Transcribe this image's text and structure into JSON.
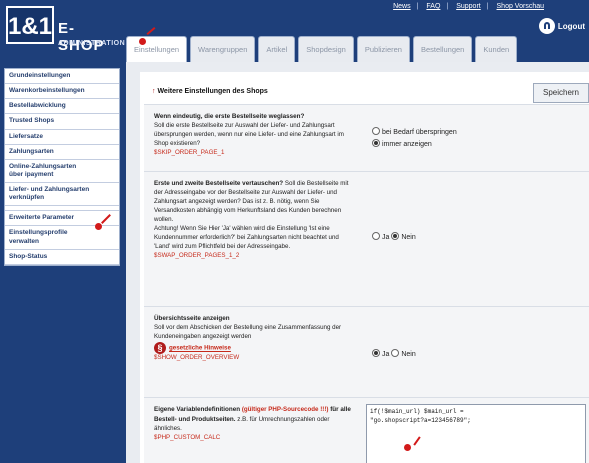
{
  "brand": {
    "logo": "1&1",
    "shop": "E-SHOP",
    "admin": "ADMINISTRATION"
  },
  "toplinks": [
    "News",
    "FAQ",
    "Support",
    "Shop Vorschau"
  ],
  "logout_label": "Logout",
  "tabs": [
    "Einstellungen",
    "Warengruppen",
    "Artikel",
    "Shopdesign",
    "Publizieren",
    "Bestellungen",
    "Kunden"
  ],
  "sidebar": {
    "items": [
      "Grundeinstellungen",
      "Warenkorbeinstellungen",
      "Bestellabwicklung",
      "Trusted Shops",
      "Liefersatze",
      "Zahlungsarten",
      "Online-Zahlungsarten\nüber ipayment",
      "Liefer- und Zahlungsarten\nverknüpfen"
    ],
    "items2": [
      "Erweiterte Parameter",
      "Einstellungsprofile\nverwalten",
      "Shop-Status"
    ]
  },
  "heading": "Weitere Einstellungen des Shops",
  "save_label": "Speichern",
  "settings": [
    {
      "title": "Wenn eindeutig, die erste Bestellseite weglassen?",
      "text": "Soll die erste Bestellseite zur Auswahl der Liefer- und Zahlungsart übersprungen werden, wenn nur eine Liefer- und eine Zahlungsart im Shop existieren?",
      "var": "$SKIP_ORDER_PAGE_1",
      "options": [
        "bei Bedarf überspringen",
        "immer anzeigen"
      ]
    },
    {
      "title": "Erste und zweite Bestellseite vertauschen?",
      "text": "Soll die Bestellseite mit der Adresseingabe vor der Bestellseite zur Auswahl der Liefer- und Zahlungsart angezeigt werden? Das ist z. B. nötig, wenn Sie Versandkosten abhängig vom Herkunftsland des Kunden berechnen wollen.",
      "warning": "Achtung! Wenn Sie Hier 'Ja' wählen wird die Einstellung 'Ist eine Kundennummer erforderlich?' bei Zahlungsarten nicht beachtet und 'Land' wird zum Pflichtfeld bei der Adresseingabe.",
      "var": "$SWAP_ORDER_PAGES_1_2",
      "options": [
        "Ja",
        "Nein"
      ]
    },
    {
      "title": "Übersichtsseite anzeigen",
      "text": "Soll vor dem Abschicken der Bestellung eine Zusammenfassung der Kundeneingaben angezeigt werden",
      "link": "gesetzliche Hinweise",
      "var": "$SHOW_ORDER_OVERVIEW",
      "options": [
        "Ja",
        "Nein"
      ]
    },
    {
      "title": "Eigene Variablendefinitionen",
      "title_red": "(gültiger PHP-Sourcecode !!!)",
      "title_end": "für alle Bestell- und Produktseiten.",
      "text": "z.B. für Umrechnungszahlen oder ähnliches.",
      "var": "$PHP_CUSTOM_CALC",
      "code": "if(!$main_url) $main_url =\n\"go.shopscript?a=123456789\";"
    }
  ]
}
